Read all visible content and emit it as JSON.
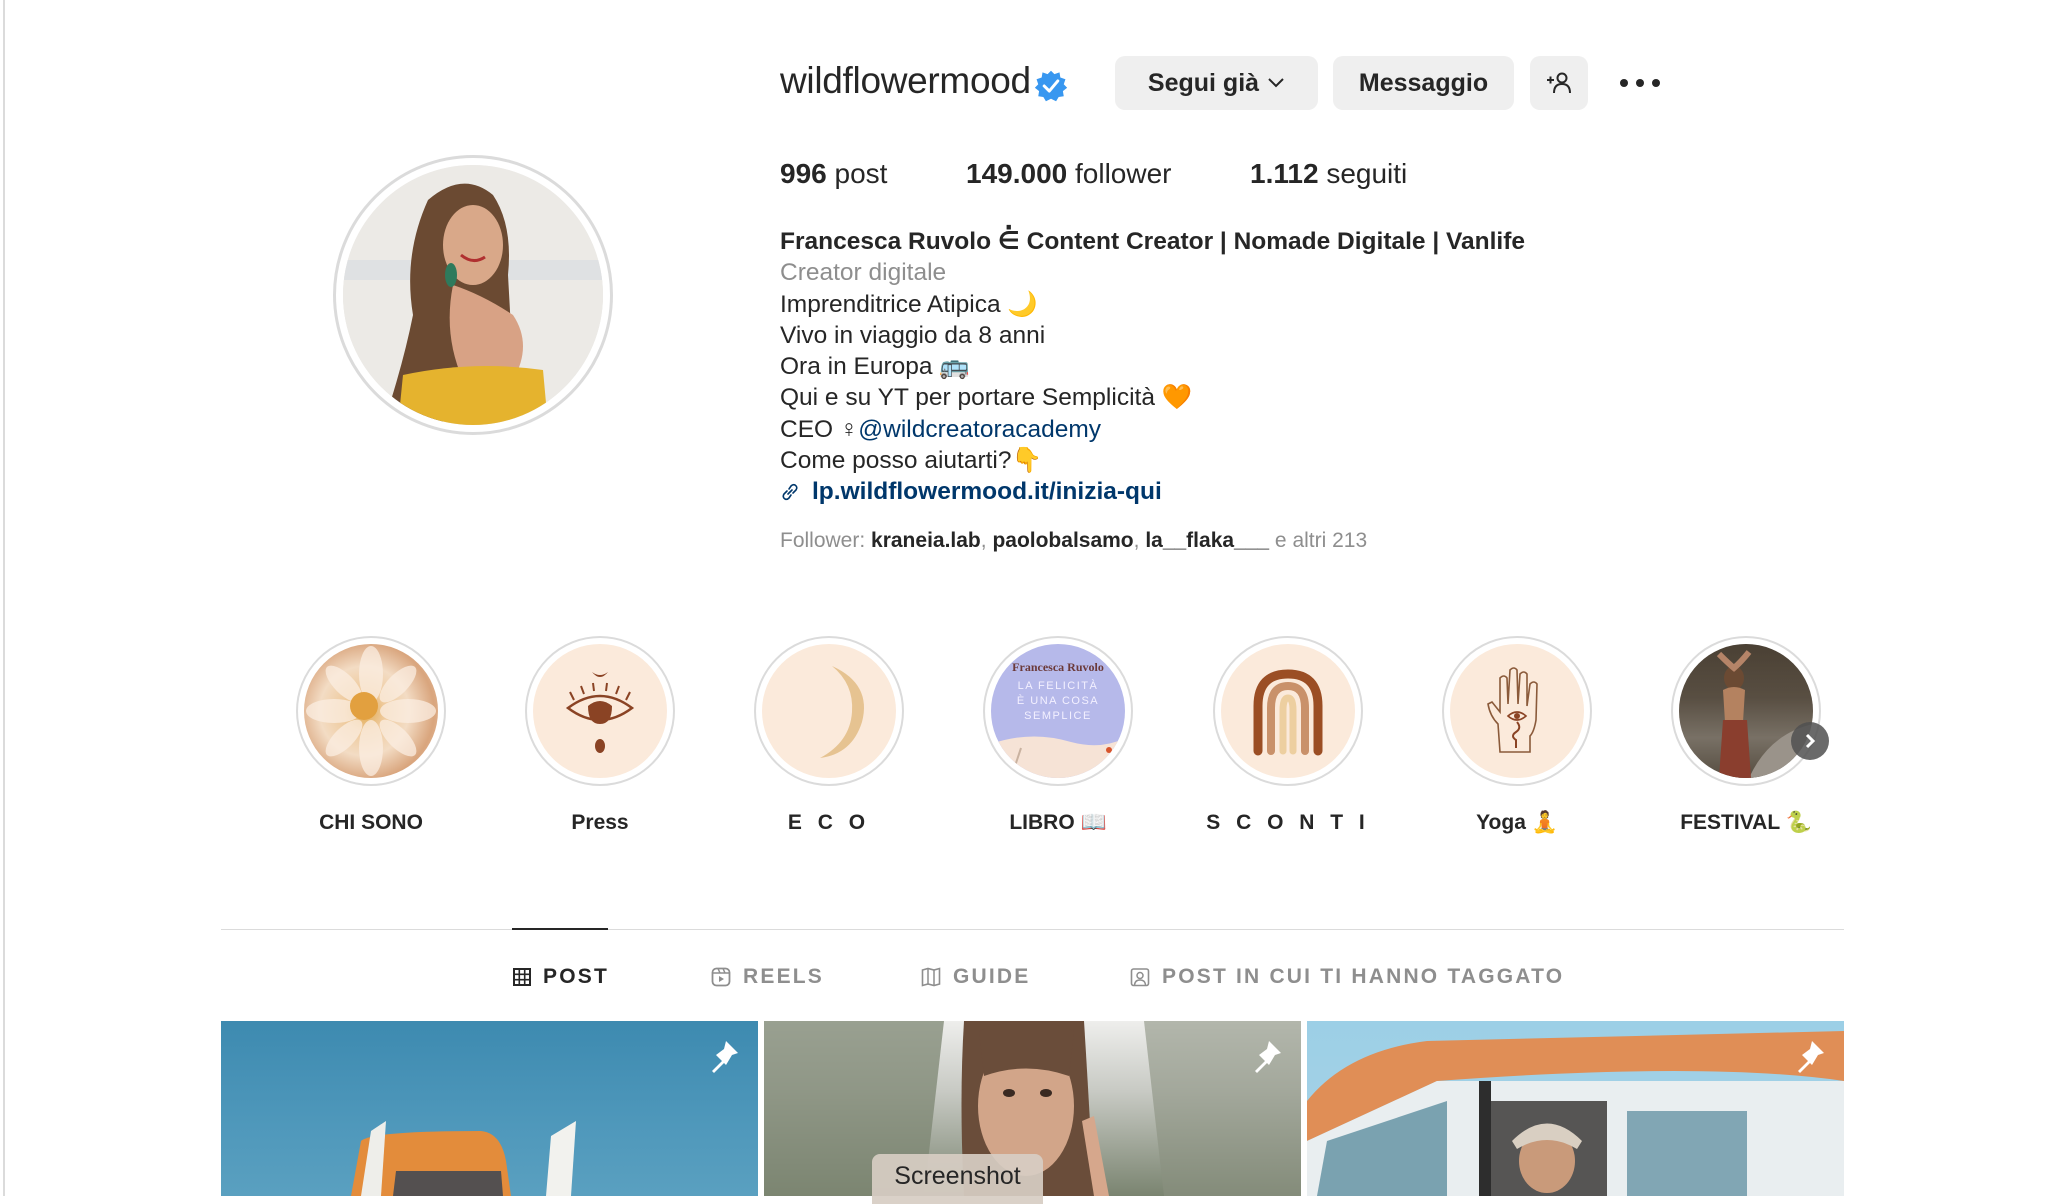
{
  "profile": {
    "username": "wildflowermood",
    "verified": true,
    "verified_icon": "verified-badge-icon",
    "accent_color": "#3897f0"
  },
  "actions": {
    "following_label": "Segui già",
    "message_label": "Messaggio",
    "suggest_icon": "add-person-icon",
    "more_icon": "more-options-icon"
  },
  "stats": {
    "posts_count": "996",
    "posts_label": "post",
    "followers_count": "149.000",
    "followers_label": "follower",
    "following_count": "1.112",
    "following_label": "seguiti"
  },
  "bio": {
    "full_name": "Francesca Ruvolo ⋵ Content Creator | Nomade Digitale | Vanlife",
    "category": "Creator digitale",
    "lines": [
      "Imprenditrice Atipica 🌙",
      "Vivo in viaggio da 8 anni",
      "Ora in Europa 🚌",
      "Qui e su YT per portare Semplicità 🧡"
    ],
    "ceo_prefix": "CEO ♀",
    "ceo_mention": "@wildcreatoracademy",
    "help_line": "Come posso aiutarti?👇",
    "link": "lp.wildflowermood.it/inizia-qui",
    "link_icon": "link-icon"
  },
  "followed_by": {
    "prefix": "Follower: ",
    "users": [
      "kraneia.lab",
      "paolobalsamo",
      "la__flaka___"
    ],
    "suffix": " e altri 213"
  },
  "highlights": [
    {
      "label": "CHI SONO",
      "icon": "flower-image"
    },
    {
      "label": "Press",
      "icon": "eye-icon"
    },
    {
      "label": "E C O",
      "icon": "moon-icon"
    },
    {
      "label": "LIBRO 📖",
      "icon": "book-cover-image",
      "cover_author": "Francesca Ruvolo",
      "cover_title": "LA FELICITÀ È UNA COSA SEMPLICE"
    },
    {
      "label": "S C O N T I",
      "icon": "rainbow-icon"
    },
    {
      "label": "Yoga 🧘",
      "icon": "hamsa-hand-icon"
    },
    {
      "label": "FESTIVAL 🐍",
      "icon": "festival-photo"
    }
  ],
  "tabs": [
    {
      "label": "POST",
      "icon": "grid-icon",
      "active": true
    },
    {
      "label": "REELS",
      "icon": "reels-icon",
      "active": false
    },
    {
      "label": "GUIDE",
      "icon": "guide-icon",
      "active": false
    },
    {
      "label": "POST IN CUI TI HANNO TAGGATO",
      "icon": "tagged-icon",
      "active": false
    }
  ],
  "posts": [
    {
      "pinned": true,
      "description": "orange van against blue sky"
    },
    {
      "pinned": true,
      "description": "woman with bangs among trees"
    },
    {
      "pinned": true,
      "description": "woman in hat in van window"
    }
  ],
  "tooltip": "Screenshot"
}
